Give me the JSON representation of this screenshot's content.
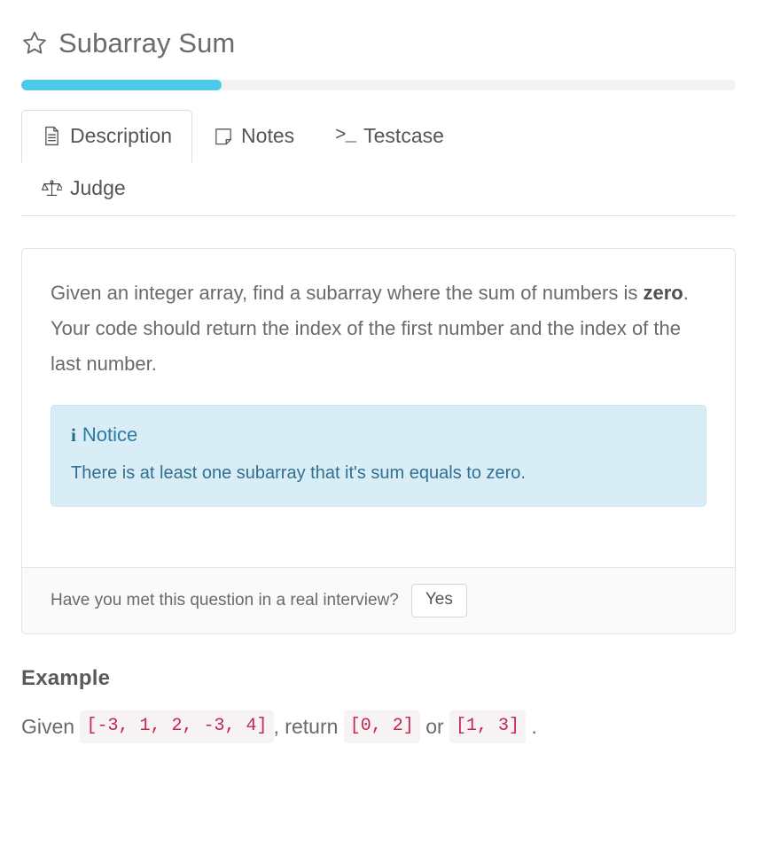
{
  "header": {
    "star_icon": "star-outline-icon",
    "title": "Subarray Sum",
    "progress_percent": 28
  },
  "tabs": [
    {
      "id": "description",
      "label": "Description",
      "icon": "document-icon",
      "active": true
    },
    {
      "id": "notes",
      "label": "Notes",
      "icon": "sticky-note-icon",
      "active": false
    },
    {
      "id": "testcase",
      "label": "Testcase",
      "icon": "terminal-prompt-icon",
      "icon_glyph": ">_",
      "active": false
    },
    {
      "id": "judge",
      "label": "Judge",
      "icon": "balance-scale-icon",
      "active": false
    }
  ],
  "description": {
    "paragraph_pre": "Given an integer array, find a subarray where the sum of numbers is ",
    "paragraph_bold": "zero",
    "paragraph_post": ". Your code should return the index of the first number and the index of the last number.",
    "notice": {
      "icon": "info-icon",
      "icon_glyph": "i",
      "title": "Notice",
      "body": "There is at least one subarray that it's sum equals to zero."
    },
    "footer": {
      "question": "Have you met this question in a real interview?",
      "yes_label": "Yes"
    }
  },
  "example": {
    "heading": "Example",
    "given_label": "Given ",
    "input_code": "[-3, 1, 2, -3, 4]",
    "comma_label": ", return ",
    "output_code_1": "[0, 2]",
    "or_label": " or ",
    "output_code_2": "[1, 3]",
    "period_label": " ."
  },
  "colors": {
    "accent_progress": "#4ec8e8",
    "notice_bg": "#d9edf7",
    "notice_text": "#31708f",
    "code_text": "#c7254e",
    "code_bg": "#f7f3f4"
  }
}
